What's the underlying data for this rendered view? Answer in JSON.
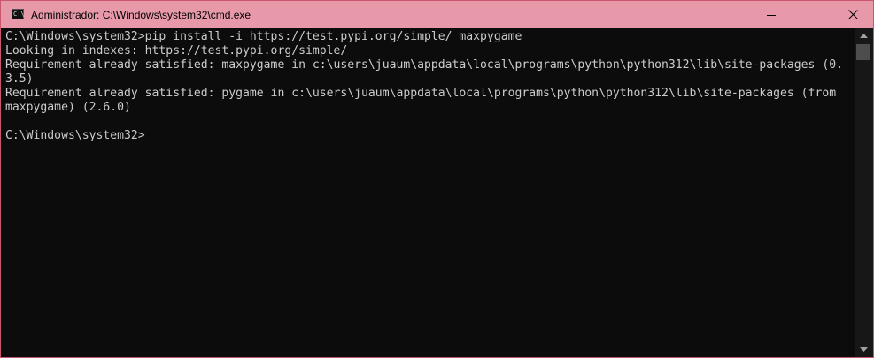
{
  "window": {
    "title": "Administrador: C:\\Windows\\system32\\cmd.exe",
    "icon": "cmd-icon",
    "icon_glyph": "C:\\",
    "controls": {
      "minimize_icon": "minimize-icon",
      "maximize_icon": "maximize-icon",
      "close_icon": "close-icon"
    },
    "titlebar_color": "#e799a9",
    "border_color": "#c8576d"
  },
  "console": {
    "background": "#0c0c0c",
    "foreground": "#cccccc",
    "lines": [
      "C:\\Windows\\system32>pip install -i https://test.pypi.org/simple/ maxpygame",
      "Looking in indexes: https://test.pypi.org/simple/",
      "Requirement already satisfied: maxpygame in c:\\users\\juaum\\appdata\\local\\programs\\python\\python312\\lib\\site-packages (0.",
      "3.5)",
      "Requirement already satisfied: pygame in c:\\users\\juaum\\appdata\\local\\programs\\python\\python312\\lib\\site-packages (from",
      "maxpygame) (2.6.0)",
      "",
      "C:\\Windows\\system32>"
    ]
  },
  "scrollbar": {
    "up_icon": "scroll-up-arrow-icon",
    "down_icon": "scroll-down-arrow-icon"
  }
}
